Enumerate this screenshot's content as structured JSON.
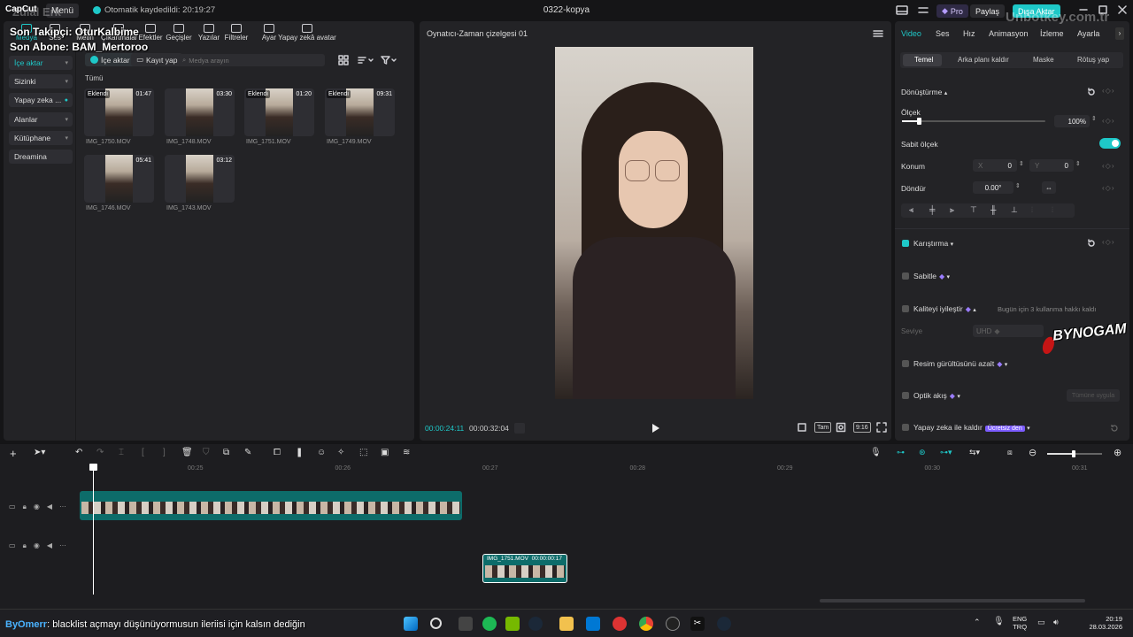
{
  "titlebar": {
    "app_logo": "CapCut",
    "menu_label": "Menü",
    "autosave_text": "Otomatik kaydedildi: 20:19:27",
    "project_title": "0322-kopya",
    "pro_label": "Pro",
    "share_label": "Paylaş",
    "export_label": "Dışa Aktar"
  },
  "overlay": {
    "streamer_name": "Zülal Erk",
    "last_follower": "Son Takipçi: OturKalbime",
    "last_subscriber": "Son Abone: BAM_Mertoroo",
    "site_watermark": "Unbotkey.com.tr",
    "brand_watermark": "BYNOGAM",
    "chat_user": "ByOmerr",
    "chat_message": ": blacklist açmayı düşünüyormusun ileriisi için kalsın dediğin"
  },
  "media_tabs": [
    {
      "label": "Medya",
      "icon": "media-icon"
    },
    {
      "label": "Ses",
      "icon": "audio-icon"
    },
    {
      "label": "Metin",
      "icon": "text-icon"
    },
    {
      "label": "Çıkartmalar",
      "icon": "sticker-icon"
    },
    {
      "label": "Efektler",
      "icon": "effects-icon"
    },
    {
      "label": "Geçişler",
      "icon": "transitions-icon"
    },
    {
      "label": "Yazılar",
      "icon": "captions-icon"
    },
    {
      "label": "Filtreler",
      "icon": "filters-icon"
    },
    {
      "label": "Ayar",
      "icon": "adjust-icon"
    },
    {
      "label": "Yapay zekâ avatar",
      "icon": "ai-avatar-icon"
    }
  ],
  "sidebar": {
    "items": [
      {
        "label": "İçe aktar"
      },
      {
        "label": "Sizinki"
      },
      {
        "label": "Yapay zeka ..."
      },
      {
        "label": "Alanlar"
      },
      {
        "label": "Kütüphane"
      },
      {
        "label": "Dreamina"
      }
    ]
  },
  "media_toolbar": {
    "import_label": "İçe aktar",
    "record_label": "Kayıt yap",
    "search_placeholder": "Medya arayın"
  },
  "media": {
    "section_label": "Tümü",
    "items": [
      {
        "name": "IMG_1750.MOV",
        "duration": "01:47",
        "badge": "Eklendi"
      },
      {
        "name": "IMG_1748.MOV",
        "duration": "03:30",
        "badge": ""
      },
      {
        "name": "IMG_1751.MOV",
        "duration": "01:20",
        "badge": "Eklendi"
      },
      {
        "name": "IMG_1749.MOV",
        "duration": "09:31",
        "badge": "Eklendi"
      },
      {
        "name": "IMG_1746.MOV",
        "duration": "05:41",
        "badge": ""
      },
      {
        "name": "IMG_1743.MOV",
        "duration": "03:12",
        "badge": ""
      }
    ]
  },
  "player": {
    "title": "Oynatıcı-Zaman çizelgesi 01",
    "current_time": "00:00:24:11",
    "total_time": "00:00:32:04",
    "full_label": "Tam",
    "ratio_label": "9:16"
  },
  "inspector": {
    "tabs": [
      "Video",
      "Ses",
      "Hız",
      "Animasyon",
      "İzleme",
      "Ayarla"
    ],
    "subtabs": [
      "Temel",
      "Arka planı kaldır",
      "Maske",
      "Rötuş yap"
    ],
    "transform_label": "Dönüştürme",
    "scale_label": "Ölçek",
    "scale_value": "100%",
    "scale_fraction": 0.12,
    "uniform_scale_label": "Sabit ölçek",
    "position_label": "Konum",
    "pos_x_label": "X",
    "pos_x": "0",
    "pos_y_label": "Y",
    "pos_y": "0",
    "rotate_label": "Döndür",
    "rotate_value": "0.00°",
    "blend_label": "Karıştırma",
    "stabilize_label": "Sabitle",
    "enhance_label": "Kaliteyi iyileştir",
    "enhance_note": "Bugün için 3 kullanma hakkı kaldı",
    "level_label": "Seviye",
    "level_value": "UHD",
    "denoise_label": "Resim gürültüsünü azalt",
    "optical_flow_label": "Optik akış",
    "apply_all_label": "Tümüne uygula",
    "ai_remove_label": "Yapay zeka ile kaldır",
    "free_badge": "Ücretsiz den"
  },
  "timeline": {
    "ruler_ticks": [
      "00:25",
      "00:26",
      "00:27",
      "00:28",
      "00:29",
      "00:30",
      "00:31"
    ],
    "clip2_name": "IMG_1751.MOV",
    "clip2_duration": "00:00:00:17"
  },
  "taskbar": {
    "lang_top": "ENG",
    "lang_bottom": "TRQ",
    "time": "20:19",
    "date": "28.03.2026"
  },
  "colors": {
    "accent": "#1ec8c8",
    "track": "#0d6c6a",
    "panel": "#232326"
  }
}
